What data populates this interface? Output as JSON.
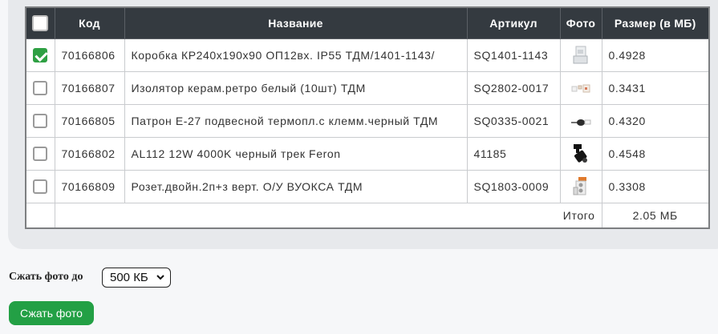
{
  "table": {
    "headers": {
      "code": "Код",
      "name": "Название",
      "article": "Артикул",
      "photo": "Фото",
      "size": "Размер (в МБ)"
    },
    "rows": [
      {
        "checked": true,
        "code": "70166806",
        "name": "Коробка КР240х190х90 ОП12вх. IP55 ТДМ/1401-1143/",
        "article": "SQ1401-1143",
        "photo_icon": "junction-box-photo",
        "size": "0.4928"
      },
      {
        "checked": false,
        "code": "70166807",
        "name": "Изолятор керам.ретро белый (10шт) ТДМ",
        "article": "SQ2802-0017",
        "photo_icon": "insulator-photo",
        "size": "0.3431"
      },
      {
        "checked": false,
        "code": "70166805",
        "name": "Патрон Е-27 подвесной термопл.с клемм.черный ТДМ",
        "article": "SQ0335-0021",
        "photo_icon": "lamp-socket-photo",
        "size": "0.4320"
      },
      {
        "checked": false,
        "code": "70166802",
        "name": "AL112 12W 4000K черный трек Feron",
        "article": "41185",
        "photo_icon": "track-light-photo",
        "size": "0.4548"
      },
      {
        "checked": false,
        "code": "70166809",
        "name": "Розет.двойн.2п+з верт. О/У ВУОКСА ТДМ",
        "article": "SQ1803-0009",
        "photo_icon": "socket-photo",
        "size": "0.3308"
      }
    ],
    "total_label": "Итого",
    "total_value": "2.05 МБ"
  },
  "controls": {
    "compress_label": "Сжать фото до",
    "compress_selected": "500 КБ",
    "compress_button": "Сжать фото"
  },
  "colors": {
    "header_bg": "#343a40",
    "accent_green": "#23a045"
  }
}
